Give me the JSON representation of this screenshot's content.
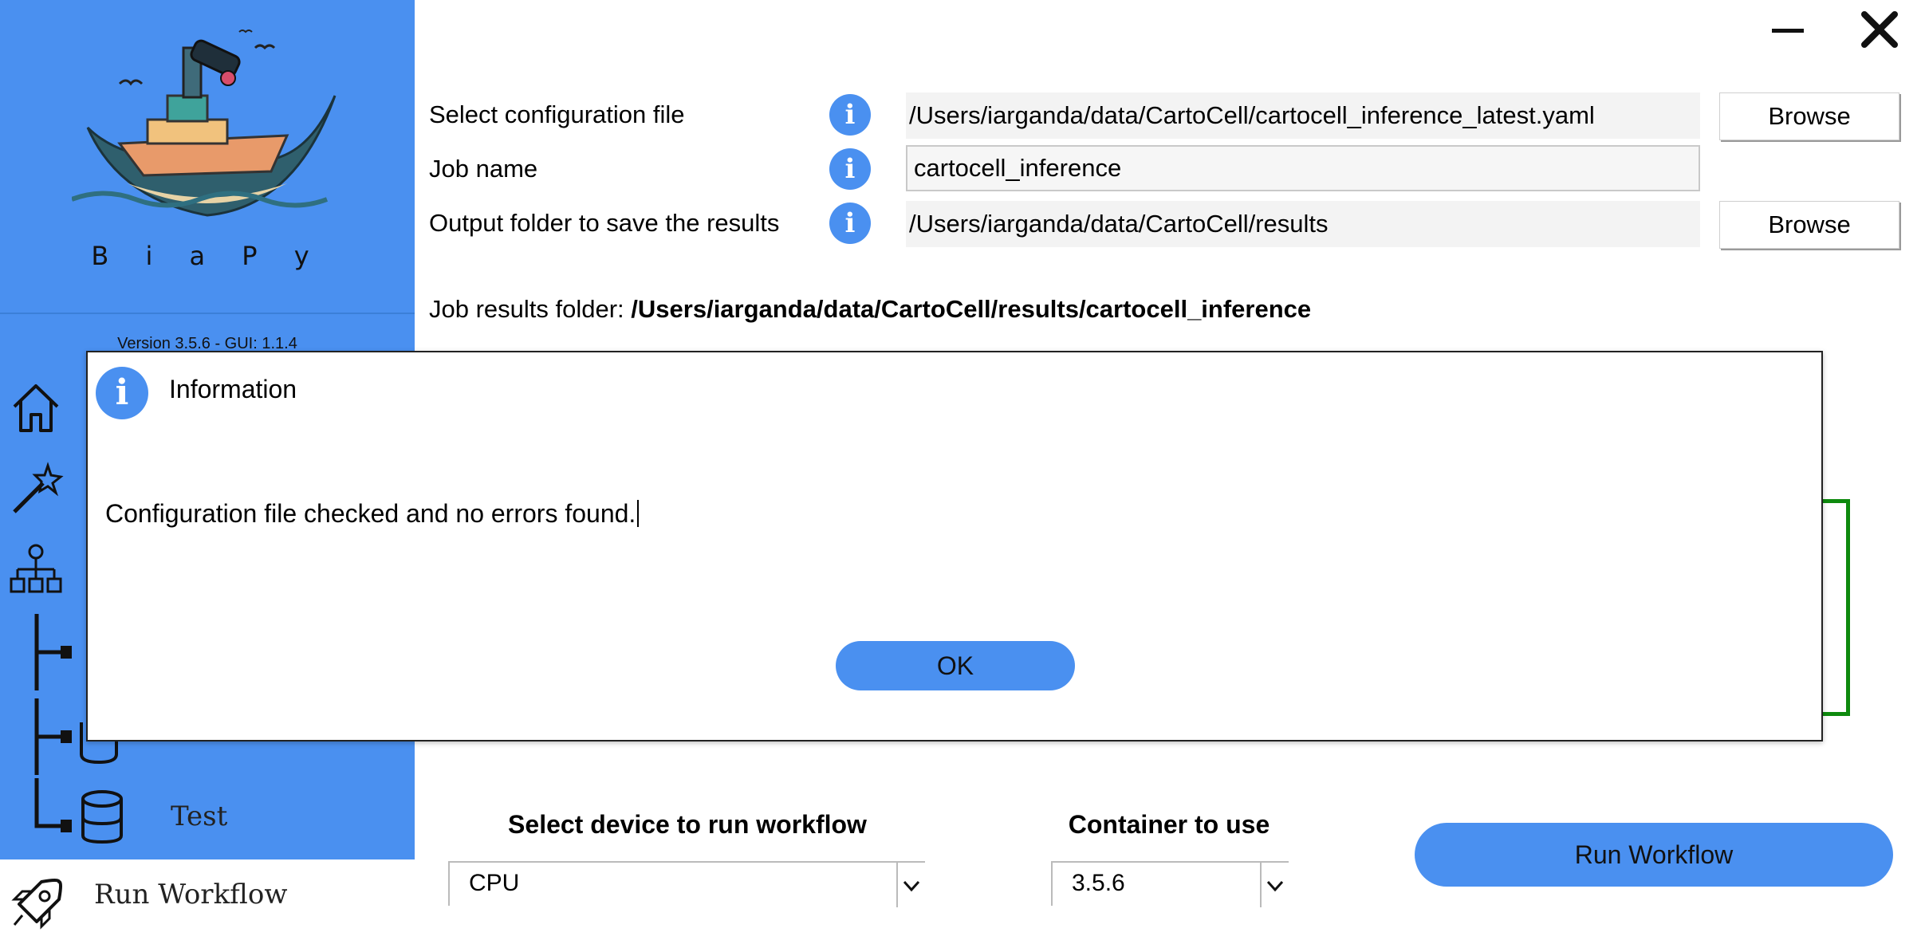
{
  "app": {
    "brand": "B i a P y",
    "version": "Version 3.5.6 - GUI: 1.1.4"
  },
  "sidebar": {
    "items": [
      {
        "icon": "home-icon",
        "label": ""
      },
      {
        "icon": "wizard-icon",
        "label": ""
      },
      {
        "icon": "workflow-icon",
        "label": ""
      },
      {
        "icon": "branch-icon",
        "label": ""
      },
      {
        "icon": "branch-icon",
        "label": ""
      },
      {
        "icon": "database-icon",
        "label": "Test"
      }
    ],
    "run_label": "Run Workflow"
  },
  "form": {
    "config_label": "Select configuration file",
    "config_value": "/Users/iarganda/data/CartoCell/cartocell_inference_latest.yaml",
    "job_label": "Job name",
    "job_value": "cartocell_inference",
    "output_label": "Output folder to save the results",
    "output_value": "/Users/iarganda/data/CartoCell/results",
    "browse_label": "Browse",
    "results_prefix": "Job results folder: ",
    "results_path": "/Users/iarganda/data/CartoCell/results/cartocell_inference"
  },
  "bottom": {
    "device_label": "Select device to run workflow",
    "device_value": "CPU",
    "container_label": "Container to use",
    "container_value": "3.5.6",
    "run_button": "Run Workflow"
  },
  "dialog": {
    "title": "Information",
    "message": "Configuration file checked and no errors found.",
    "ok": "OK"
  },
  "colors": {
    "accent": "#4a90f0",
    "green_border": "#0e8a0e"
  }
}
